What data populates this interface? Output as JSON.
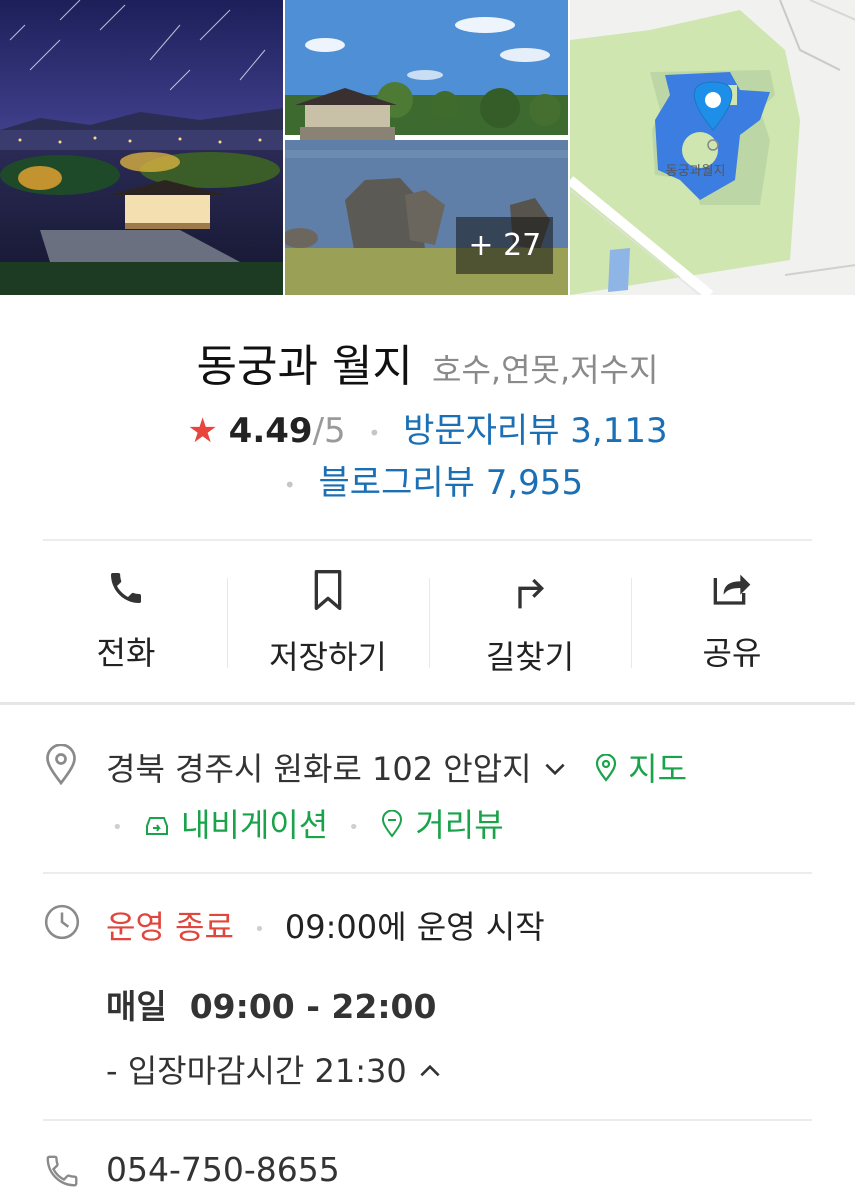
{
  "photos": {
    "more_count": "+ 27",
    "map_label": "동궁과월지"
  },
  "place": {
    "name": "동궁과 월지",
    "category": "호수,연못,저수지",
    "rating": "4.49",
    "rating_max": "/5",
    "visitor_reviews": "방문자리뷰 3,113",
    "blog_reviews": "블로그리뷰 7,955"
  },
  "actions": {
    "call": "전화",
    "save": "저장하기",
    "directions": "길찾기",
    "share": "공유"
  },
  "address": {
    "text": "경북 경주시 원화로 102 안압지",
    "map": "지도",
    "navigation": "내비게이션",
    "street_view": "거리뷰"
  },
  "hours": {
    "status": "운영 종료",
    "next_open": "09:00에 운영 시작",
    "daily_label": "매일",
    "daily_hours": "09:00 - 22:00",
    "last_entry": "- 입장마감시간 21:30"
  },
  "phone": {
    "number": "054-750-8655"
  },
  "colors": {
    "accent_blue": "#1a6fb5",
    "accent_green": "#1aa34a",
    "closed_red": "#e0463c",
    "star_red": "#e8453c"
  }
}
